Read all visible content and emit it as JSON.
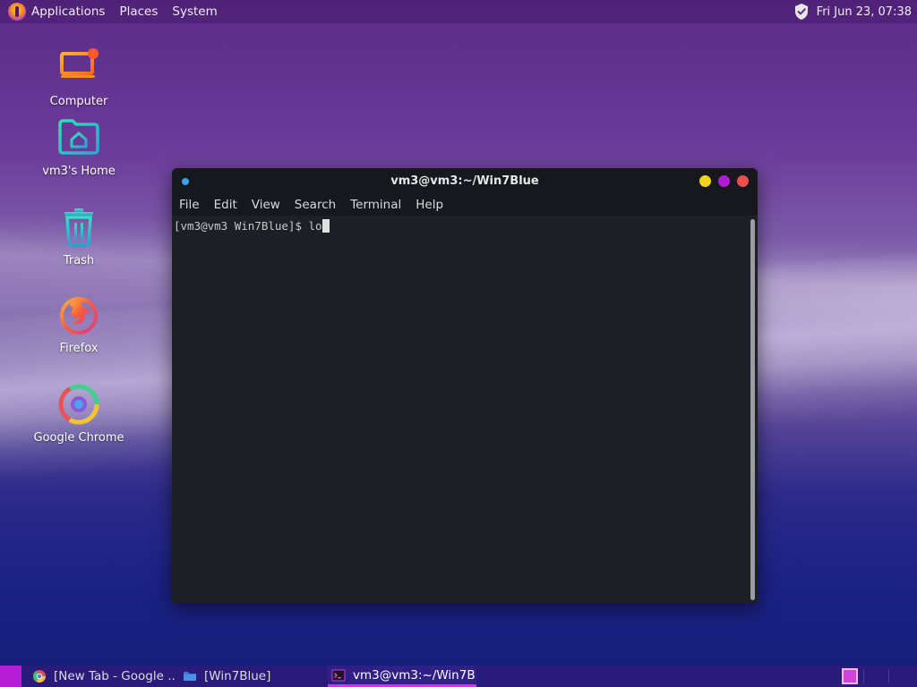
{
  "top_panel": {
    "menus": [
      "Applications",
      "Places",
      "System"
    ],
    "clock": "Fri Jun 23, 07:38"
  },
  "desktop": {
    "icons": [
      {
        "label": "Computer",
        "icon": "computer-icon"
      },
      {
        "label": "vm3's Home",
        "icon": "home-folder-icon"
      },
      {
        "label": "Trash",
        "icon": "trash-icon"
      },
      {
        "label": "Firefox",
        "icon": "firefox-icon"
      },
      {
        "label": "Google Chrome",
        "icon": "chrome-icon"
      }
    ]
  },
  "terminal": {
    "title": "vm3@vm3:~/Win7Blue",
    "menu": [
      "File",
      "Edit",
      "View",
      "Search",
      "Terminal",
      "Help"
    ],
    "prompt": "[vm3@vm3 Win7Blue]$ ",
    "input": "lo"
  },
  "taskbar": {
    "tasks": [
      {
        "label": "[New Tab - Google ...",
        "icon": "chrome-icon",
        "active": false
      },
      {
        "label": "[Win7Blue]",
        "icon": "folder-icon",
        "active": false
      },
      {
        "label": "vm3@vm3:~/Win7B...",
        "icon": "terminal-icon",
        "active": true
      }
    ]
  },
  "colors": {
    "accent": "#b81ed6",
    "terminal_bg": "#1c1f26",
    "title_close": "#ec4d4d",
    "title_max": "#b21ad6",
    "title_min": "#f2d41c"
  }
}
